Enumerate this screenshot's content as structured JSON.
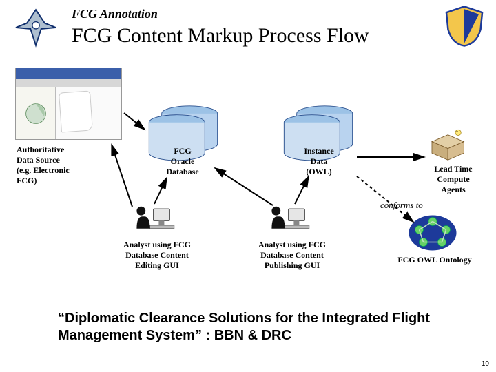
{
  "header": {
    "kicker": "FCG Annotation",
    "title": "FCG Content Markup Process Flow"
  },
  "nodes": {
    "authoritative": "Authoritative\nData Source\n(e.g. Electronic\nFCG)",
    "oracle": "FCG\nOracle\nDatabase",
    "instance": "Instance\nData\n(OWL)",
    "lead_time": "Lead Time\nCompute\nAgents",
    "analyst_edit": "Analyst using FCG\nDatabase Content\nEditing GUI",
    "analyst_publish": "Analyst using FCG\nDatabase Content\nPublishing GUI",
    "ontology": "FCG OWL Ontology",
    "conforms": "conforms to"
  },
  "footer": {
    "quote": "“Diplomatic Clearance Solutions for the Integrated Flight Management System” : BBN & DRC",
    "page": "10"
  }
}
